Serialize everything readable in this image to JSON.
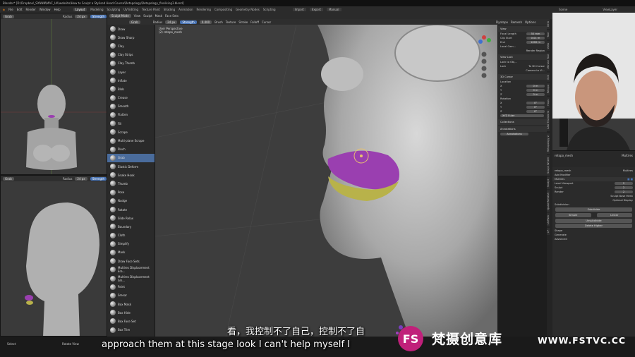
{
  "window_title": "Blender* [D:\\Dropbox\\_SXNNN\\MAC_UA\\website\\How to Sculpt a Stylised Head Course\\Retopology\\Retopology_finalising3.blend]",
  "menu": [
    "File",
    "Edit",
    "Render",
    "Window",
    "Help"
  ],
  "workspaces": [
    "Layout",
    "Modeling",
    "Sculpting",
    "UV Editing",
    "Texture Paint",
    "Shading",
    "Animation",
    "Rendering",
    "Compositing",
    "Geometry Nodes",
    "Scripting"
  ],
  "active_workspace": "Layout",
  "topbar_right": {
    "import": "Import",
    "export": "Export",
    "manual": "Manual",
    "scene": "Scene",
    "view_layer": "ViewLayer"
  },
  "small_vp1": {
    "tool": "Grab",
    "radius_label": "Radius",
    "radius": "24 px",
    "strength": "Strength"
  },
  "small_vp2": {
    "tool": "Grab",
    "radius_label": "Radius",
    "radius": "24 px",
    "strength": "Strength"
  },
  "main_vp": {
    "mode": "Sculpt Mode",
    "menus": [
      "View",
      "Sculpt",
      "Mask",
      "Face Sets"
    ],
    "tool": "Grab",
    "radius_label": "Radius",
    "radius": "24 px",
    "strength_label": "Strength",
    "strength": "0.400",
    "brush": "Brush",
    "texture": "Texture",
    "stroke": "Stroke",
    "falloff": "Falloff",
    "cursor": "Cursor",
    "perspective": "User Perspective",
    "object": "(2) retopo_mesh",
    "dyntopo": "Dyntopo",
    "remesh": "Remesh",
    "options": "Options"
  },
  "tools": [
    "Draw",
    "Draw Sharp",
    "Clay",
    "Clay Strips",
    "Clay Thumb",
    "Layer",
    "Inflate",
    "Blob",
    "Crease",
    "Smooth",
    "Flatten",
    "Fill",
    "Scrape",
    "Multi-plane Scrape",
    "Pinch",
    "Grab",
    "Elastic Deform",
    "Snake Hook",
    "Thumb",
    "Pose",
    "Nudge",
    "Rotate",
    "Slide Relax",
    "Boundary",
    "Cloth",
    "Simplify",
    "Mask",
    "Draw Face Sets",
    "Multires Displacement Era...",
    "Multires Displacement Sm...",
    "Paint",
    "Smear",
    "Box Mask",
    "Box Hide",
    "Box Face Set",
    "Box Trim"
  ],
  "active_tool": "Grab",
  "n_panel": {
    "view_header": "View",
    "focal_label": "Focal Length",
    "focal": "50 mm",
    "clip_start_label": "Clip Start",
    "clip_start": "0.01 m",
    "end_label": "End",
    "end": "1000 m",
    "local_cam": "Local Cam...",
    "render_region": "Render Region",
    "view_lock": "View Lock",
    "lock_obj": "Lock to Obj...",
    "lock": "Lock",
    "to_3d_cursor": "To 3D Cursor",
    "camera_to_view": "Camera to Vi...",
    "cursor_header": "3D Cursor",
    "location": "Location",
    "x_label": "X",
    "x": "0 m",
    "y_label": "Y",
    "y": "0 m",
    "z_label": "Z",
    "z": "0 m",
    "rotation": "Rotation",
    "rx": "0°",
    "ry": "0°",
    "rz": "0°",
    "rotation_mode": "XYZ Euler",
    "collections": "Collections",
    "annotations": "Annotations",
    "annotations_field": "Annotations"
  },
  "side_tabs": [
    "Item",
    "Tool",
    "View",
    "ZBrush Tool",
    "Edit",
    "Retopo",
    "Hops",
    "CAD Transform",
    "Retopology 2",
    "Sculpt Wheel",
    "Sculpt",
    "Quad Remesh",
    "UvPack",
    "LP"
  ],
  "outliner": {
    "object": "retopo_mesh",
    "modifier_name": "Multires"
  },
  "properties": {
    "object": "retopo_mesh",
    "modifier_tab": "Multires",
    "add_modifier": "Add Modifier",
    "modifier": "Multires",
    "level_viewport_label": "Level Viewport",
    "level_viewport": "2",
    "sculpt_label": "Sculpt",
    "sculpt": "2",
    "render_label": "Render",
    "render": "2",
    "sculpt_base_mesh": "Sculpt Base Mesh",
    "optimal_display": "Optimal Display",
    "subdivision": "Subdivision",
    "subdivide": "Subdivide",
    "simple": "Simple",
    "linear": "Linear",
    "unsubdivide": "Unsubdivide",
    "delete_higher": "Delete Higher",
    "shape": "Shape",
    "generate": "Generate",
    "advanced": "Advanced"
  },
  "status_bar": {
    "select": "Select",
    "rotate_view": "Rotate View"
  },
  "subtitle_cn": "看，我控制不了自己，控制不了自",
  "subtitle_en": "approach them at this stage look I can't help myself I",
  "watermark_cn": "梵摄创意库",
  "watermark_url": "WWW.FSTVC.CC",
  "logo_text": "FS",
  "colors": {
    "purple": "#9a3fb0",
    "yellow": "#b8b24a",
    "active_blue": "#4a6c9c",
    "viewport_bg": "#3d3d3d"
  }
}
